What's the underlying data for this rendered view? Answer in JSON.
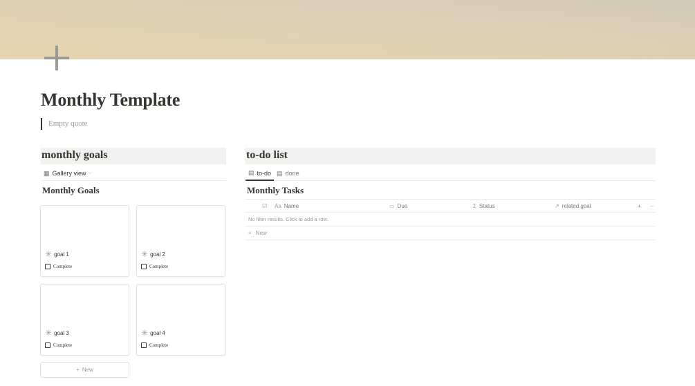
{
  "page": {
    "title": "Monthly Template",
    "quote_placeholder": "Empty quote"
  },
  "left": {
    "heading": "monthly goals",
    "view_label": "Gallery view",
    "database_title": "Monthly Goals",
    "cards": [
      {
        "name": "goal 1",
        "property": "Complete"
      },
      {
        "name": "goal 2",
        "property": "Complete"
      },
      {
        "name": "goal 3",
        "property": "Complete"
      },
      {
        "name": "goal 4",
        "property": "Complete"
      }
    ],
    "new_label": "New"
  },
  "right": {
    "heading": "to-do list",
    "tabs": [
      {
        "label": "to-do"
      },
      {
        "label": "done"
      }
    ],
    "database_title": "Monthly Tasks",
    "columns": [
      {
        "icon": "Aa",
        "label": "Name"
      },
      {
        "icon": "calendar-icon",
        "label": "Due"
      },
      {
        "icon": "formula-icon",
        "label": "Status"
      },
      {
        "icon": "relation-icon",
        "label": "related goal"
      }
    ],
    "empty_message": "No filter results. Click to add a row.",
    "new_label": "New"
  },
  "colors": {
    "text": "#37352f",
    "muted": "#9b9a97",
    "heading_bg": "#f1f1ef",
    "border": "#e9e9e7"
  }
}
